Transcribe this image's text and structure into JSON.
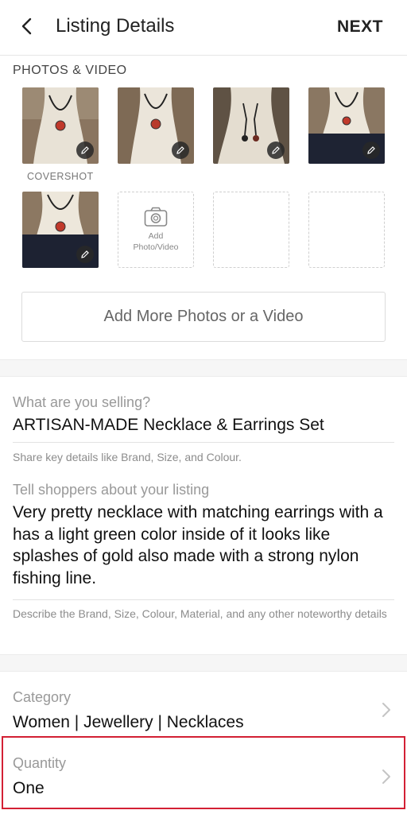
{
  "header": {
    "title": "Listing Details",
    "next_label": "NEXT"
  },
  "photos": {
    "section_label": "PHOTOS & VIDEO",
    "cover_label": "COVERSHOT",
    "add_photo_label_line1": "Add",
    "add_photo_label_line2": "Photo/Video",
    "add_more_label": "Add More Photos or a Video"
  },
  "listing": {
    "title_label": "What are you selling?",
    "title_value": "ARTISAN-MADE Necklace & Earrings Set",
    "title_hint": "Share key details like Brand, Size, and Colour.",
    "description_label": "Tell shoppers about your listing",
    "description_value": "Very pretty necklace with matching earrings with a has a light green color inside of it looks like splashes of gold also made with a strong nylon fishing line.",
    "description_hint": "Describe the Brand, Size, Colour, Material, and any other noteworthy details"
  },
  "category": {
    "label": "Category",
    "value": "Women | Jewellery | Necklaces"
  },
  "quantity": {
    "label": "Quantity",
    "value": "One"
  },
  "colors": {
    "highlight": "#d32034"
  }
}
